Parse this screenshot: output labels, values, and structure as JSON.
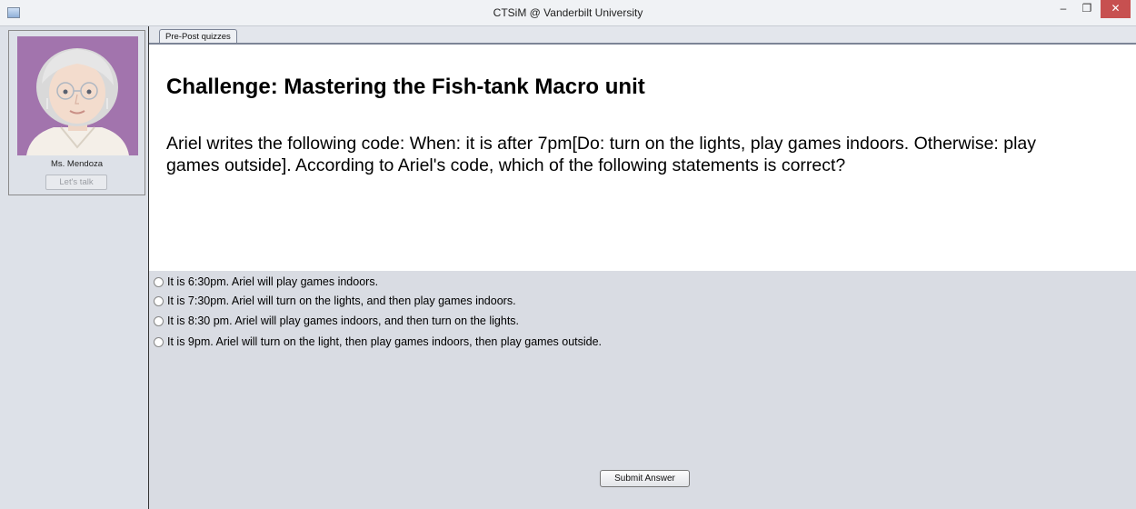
{
  "window": {
    "title": "CTSiM @ Vanderbilt University",
    "controls": {
      "minimize": "–",
      "maximize": "❐",
      "close": "✕"
    }
  },
  "agent": {
    "name": "Ms. Mendoza",
    "talk_button": "Let's talk",
    "avatar_bg": "#a274ad"
  },
  "tabs": [
    {
      "label": "Pre-Post quizzes"
    }
  ],
  "question": {
    "title": "Challenge: Mastering the Fish-tank Macro unit",
    "text": "Ariel writes the following code: When: it is after 7pm[Do: turn on the lights, play games indoors. Otherwise: play games outside]. According to Ariel's code, which of the following statements is correct?"
  },
  "options": [
    {
      "label": "It is 6:30pm. Ariel will play games indoors."
    },
    {
      "label": "It is 7:30pm. Ariel will turn on the lights, and then play games indoors."
    },
    {
      "label": "It is 8:30 pm. Ariel will play games indoors, and then turn on the lights."
    },
    {
      "label": "It is 9pm. Ariel will turn on the light, then play games indoors, then play games outside."
    }
  ],
  "submit_label": "Submit Answer"
}
